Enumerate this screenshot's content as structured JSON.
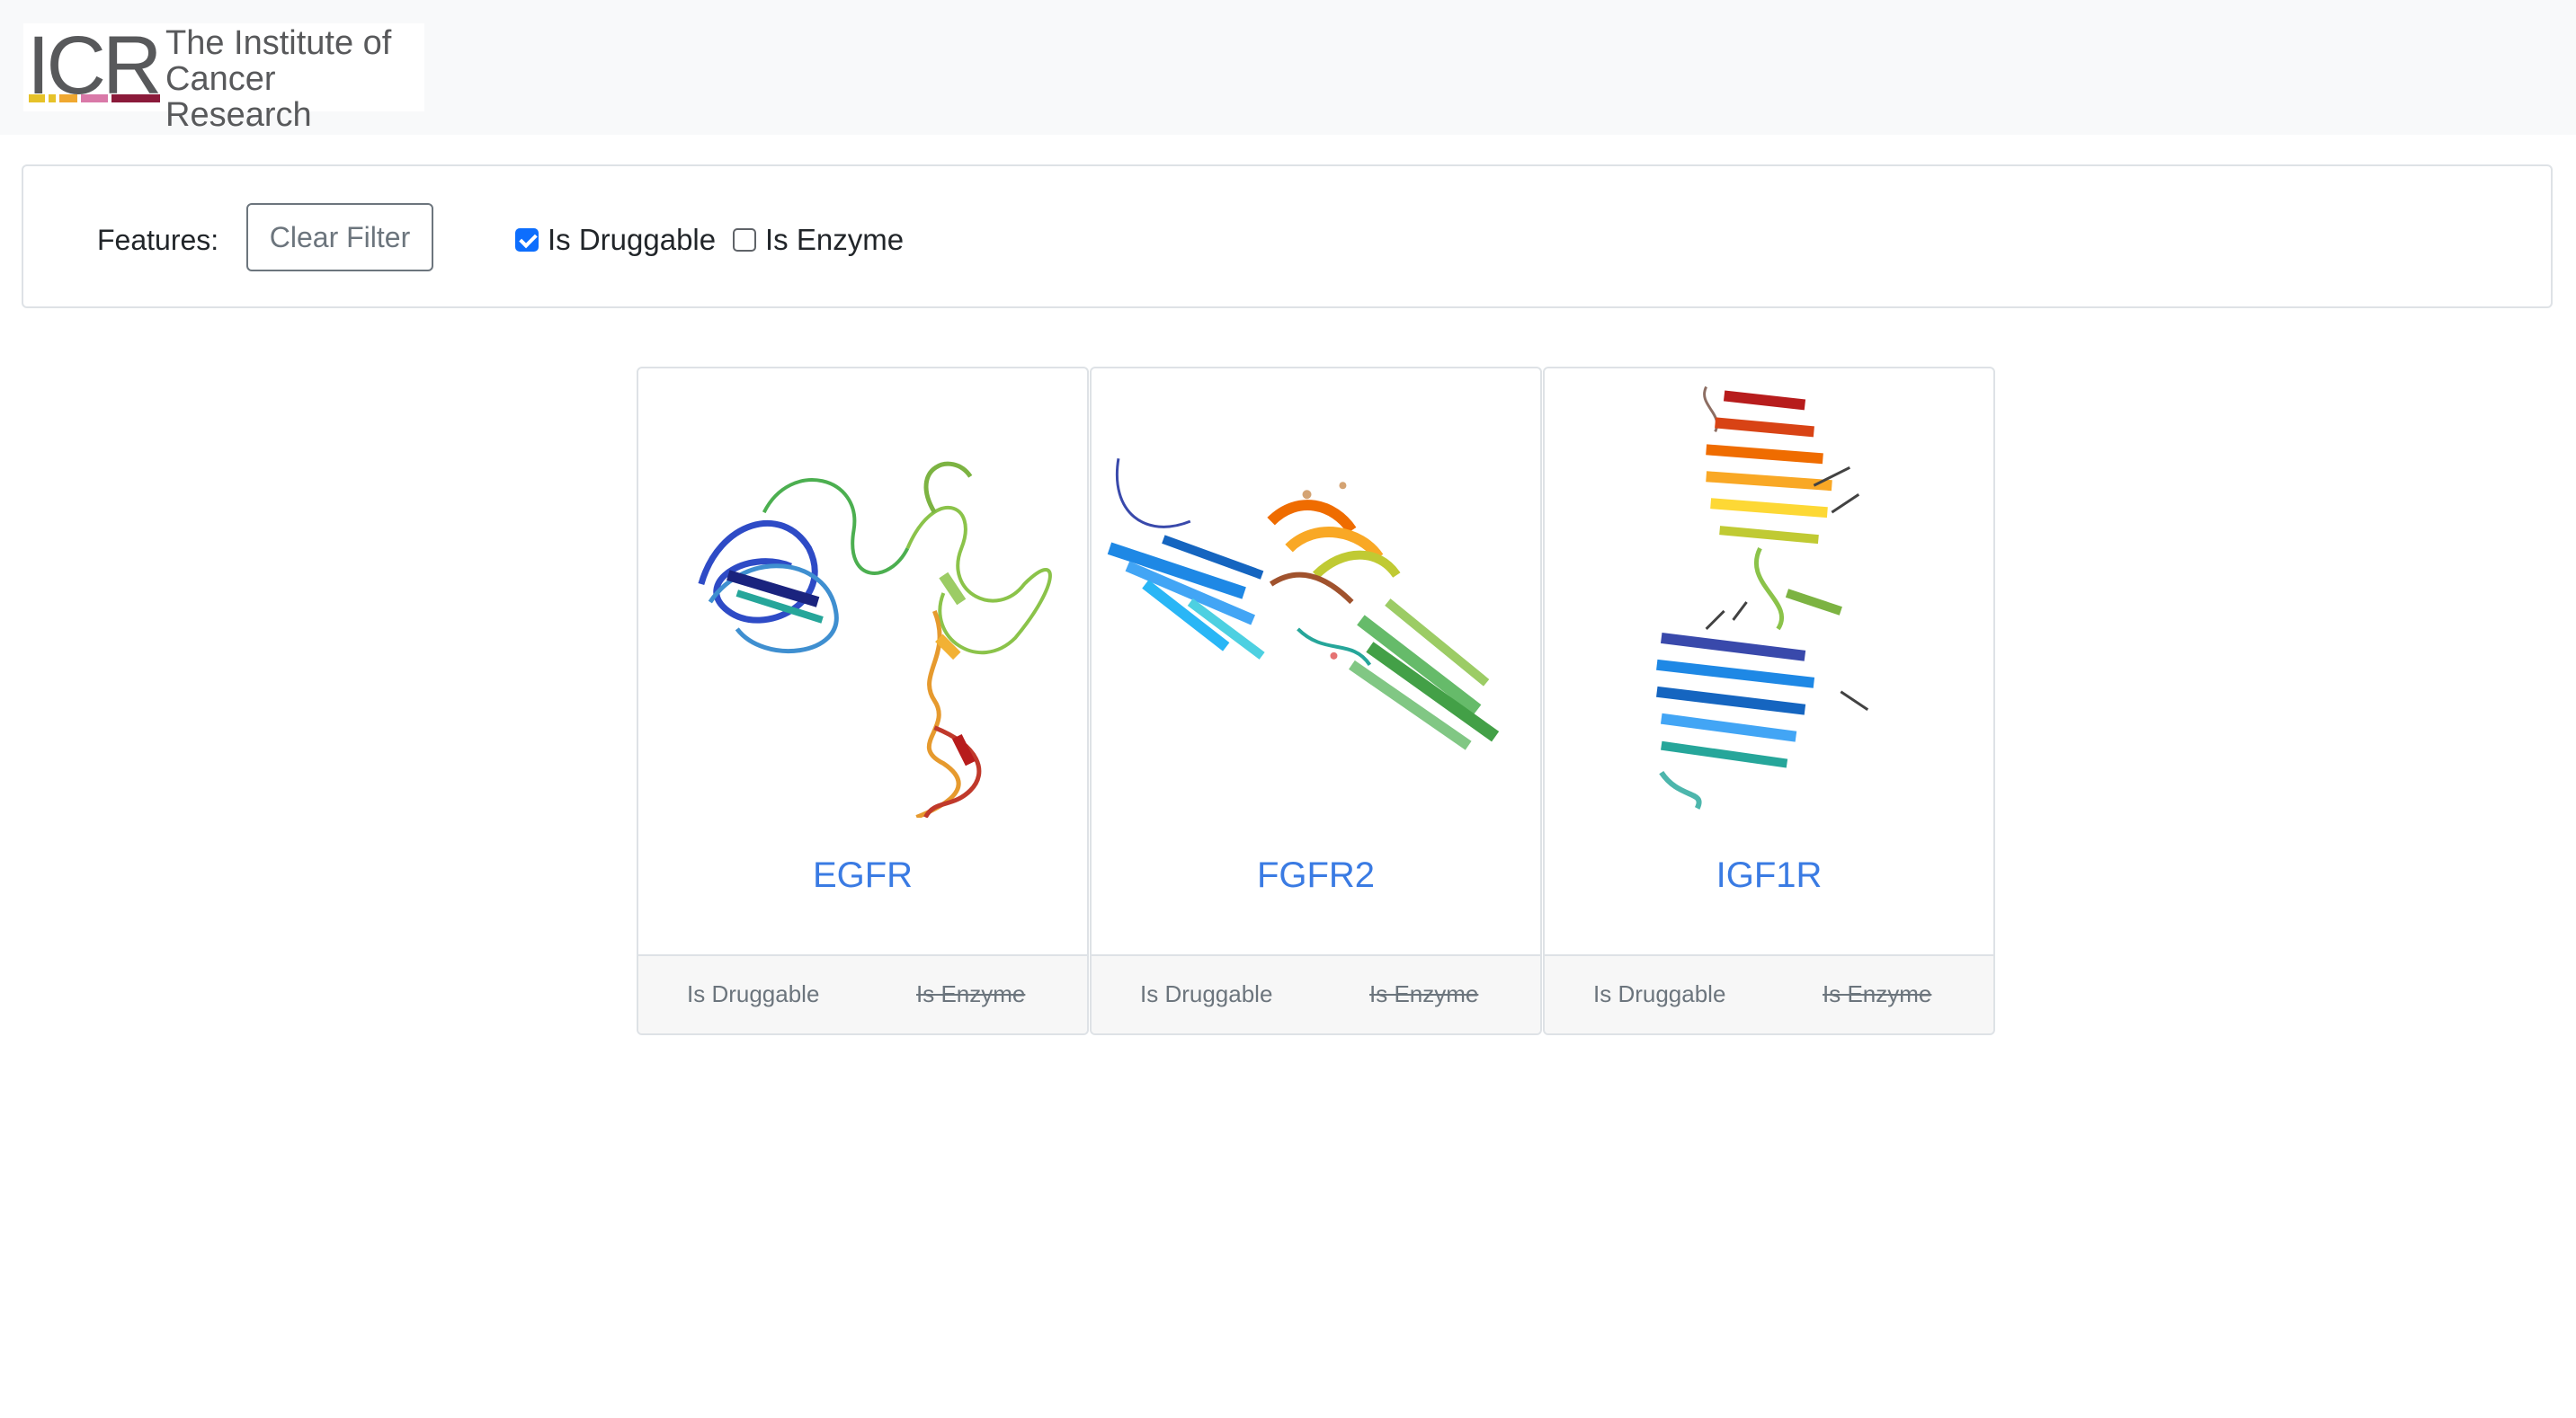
{
  "logo": {
    "abbr": "ICR",
    "line1": "The Institute of",
    "line2": "Cancer Research",
    "bar_colors": [
      "#e6c229",
      "#f0a830",
      "#d979a8",
      "#8b1a3a"
    ]
  },
  "filter": {
    "label": "Features:",
    "clear_button": "Clear Filter",
    "options": [
      {
        "label": "Is Druggable",
        "checked": true
      },
      {
        "label": "Is Enzyme",
        "checked": false
      }
    ]
  },
  "cards": [
    {
      "title": "EGFR",
      "features": [
        "Is Druggable",
        "Is Enzyme"
      ],
      "struck": [
        false,
        true
      ]
    },
    {
      "title": "FGFR2",
      "features": [
        "Is Druggable",
        "Is Enzyme"
      ],
      "struck": [
        false,
        true
      ]
    },
    {
      "title": "IGF1R",
      "features": [
        "Is Druggable",
        "Is Enzyme"
      ],
      "struck": [
        false,
        true
      ]
    }
  ],
  "colors": {
    "link": "#3a7be3",
    "checkbox": "#0d6efd",
    "muted": "#6c757d"
  }
}
